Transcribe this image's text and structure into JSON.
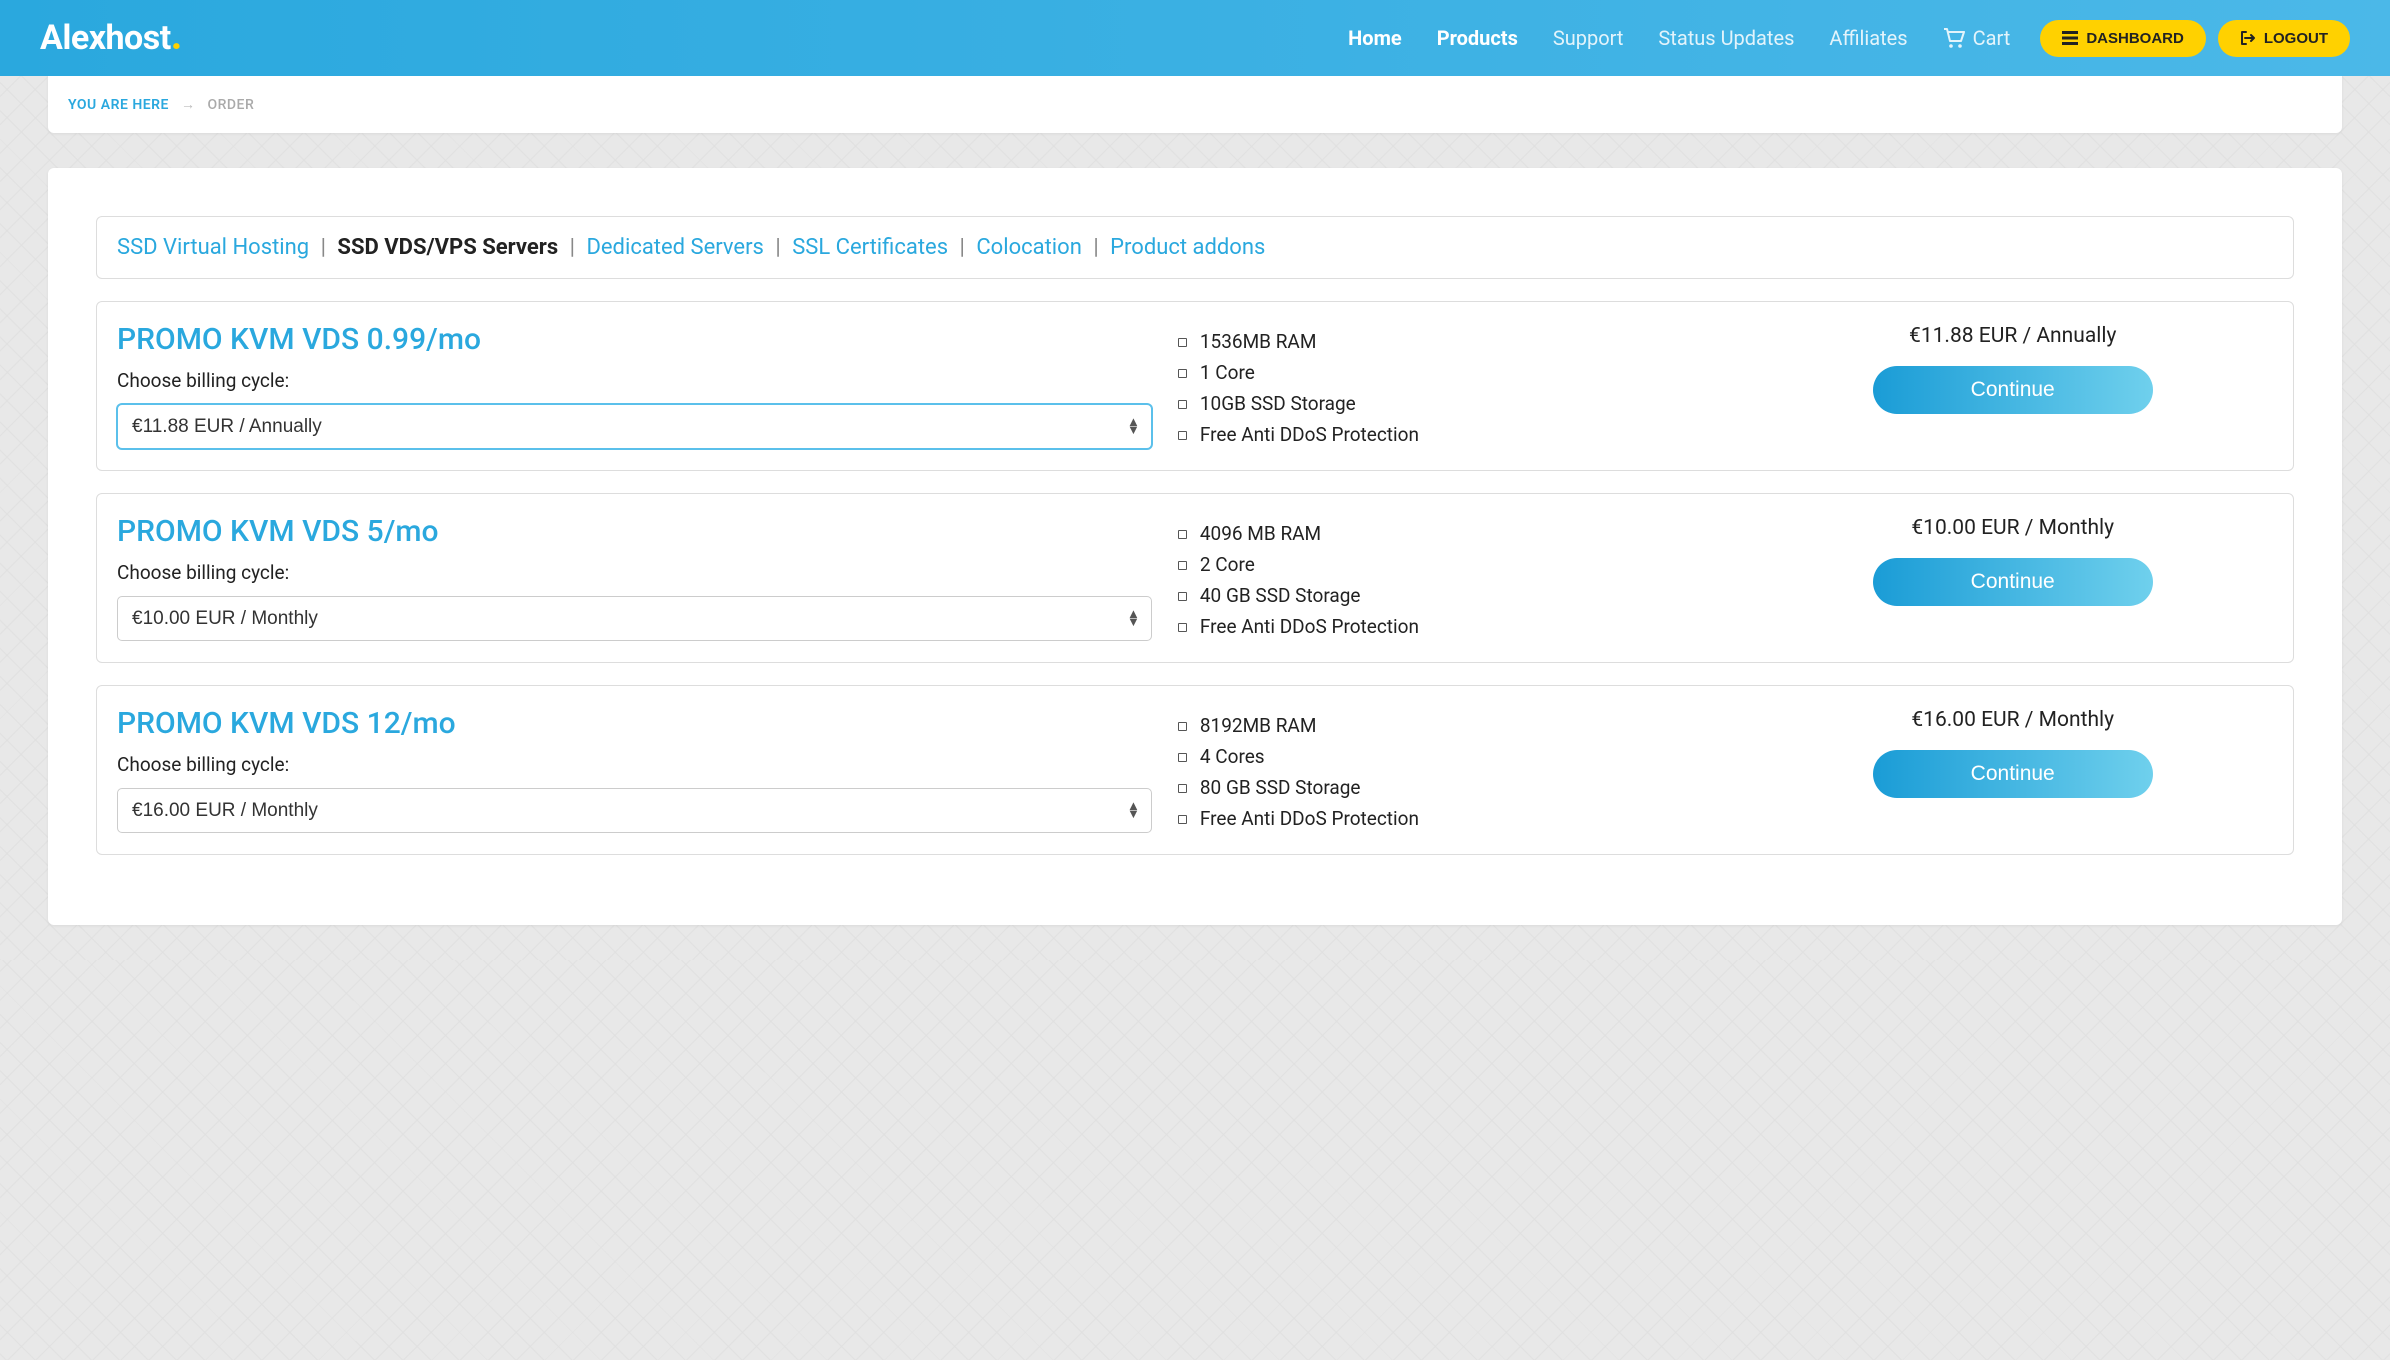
{
  "navbar": {
    "logo_text": "Alexhost",
    "links": [
      {
        "label": "Home",
        "active": true
      },
      {
        "label": "Products",
        "active": true
      },
      {
        "label": "Support",
        "active": false
      },
      {
        "label": "Status Updates",
        "active": false
      },
      {
        "label": "Affiliates",
        "active": false
      }
    ],
    "cart_label": "Cart",
    "dashboard_label": "DASHBOARD",
    "logout_label": "LOGOUT"
  },
  "breadcrumb": {
    "root": "YOU ARE HERE",
    "current": "ORDER"
  },
  "categories": [
    {
      "label": "SSD Virtual Hosting",
      "active": false
    },
    {
      "label": "SSD VDS/VPS Servers",
      "active": true
    },
    {
      "label": "Dedicated Servers",
      "active": false
    },
    {
      "label": "SSL Certificates",
      "active": false
    },
    {
      "label": "Colocation",
      "active": false
    },
    {
      "label": "Product addons",
      "active": false
    }
  ],
  "billing_label": "Choose billing cycle:",
  "continue_label": "Continue",
  "products": [
    {
      "title": "PROMO KVM VDS 0.99/mo",
      "price": "€11.88 EUR / Annually",
      "selected_cycle": "€11.88 EUR / Annually",
      "focused": true,
      "specs": [
        "1536MB RAM",
        "1 Core",
        "10GB SSD Storage",
        "Free Anti DDoS Protection"
      ]
    },
    {
      "title": "PROMO KVM VDS 5/mo",
      "price": "€10.00 EUR / Monthly",
      "selected_cycle": "€10.00 EUR / Monthly",
      "focused": false,
      "specs": [
        "4096 MB RAM",
        "2 Core",
        "40 GB SSD Storage",
        "Free Anti DDoS Protection"
      ]
    },
    {
      "title": "PROMO KVM VDS 12/mo",
      "price": "€16.00 EUR / Monthly",
      "selected_cycle": "€16.00 EUR / Monthly",
      "focused": false,
      "specs": [
        "8192MB RAM",
        "4 Cores",
        "80 GB SSD Storage",
        "Free Anti DDoS Protection"
      ]
    }
  ]
}
